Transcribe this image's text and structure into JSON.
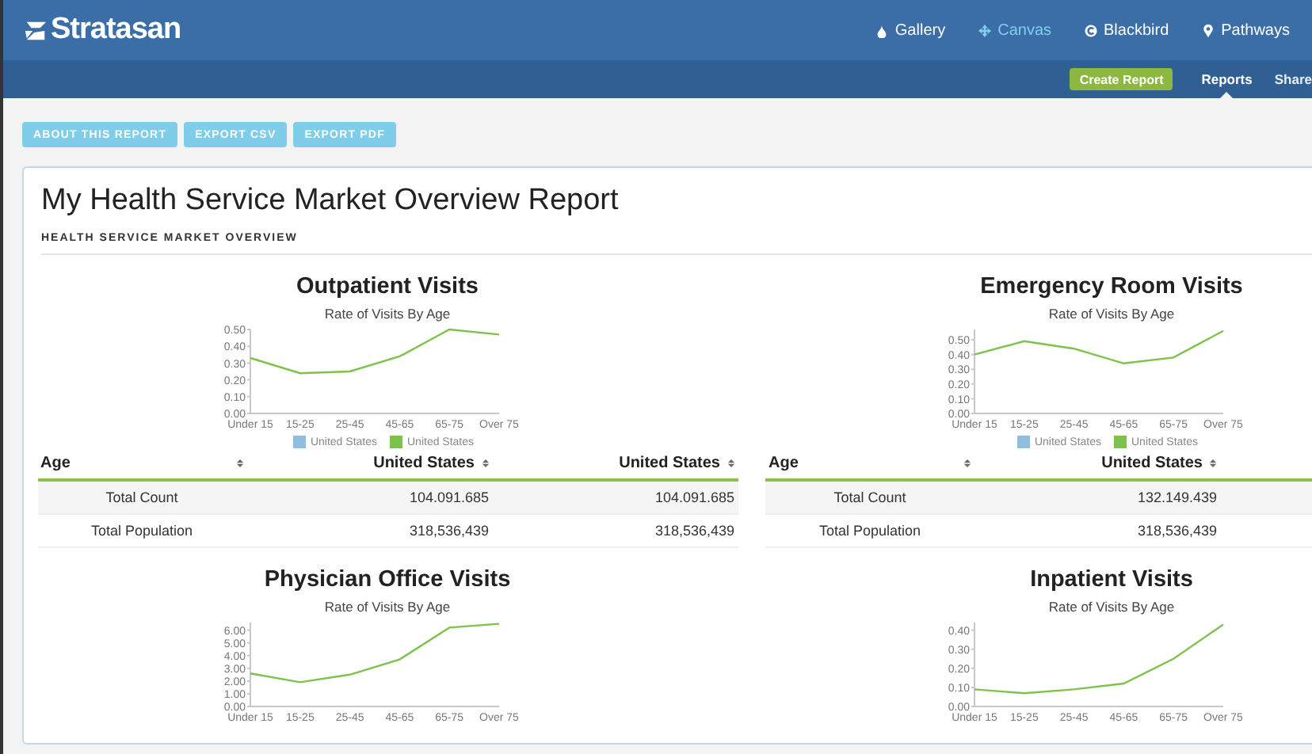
{
  "header": {
    "logo": "Stratasan",
    "nav": [
      {
        "label": "Gallery",
        "kind": "drop",
        "selected": false
      },
      {
        "label": "Canvas",
        "kind": "move",
        "selected": true
      },
      {
        "label": "Blackbird",
        "kind": "ring",
        "selected": false
      },
      {
        "label": "Pathways",
        "kind": "pin",
        "selected": false
      }
    ]
  },
  "subnav": {
    "create_button": "Create Report",
    "tabs": [
      {
        "label": "Reports",
        "selected": true
      },
      {
        "label": "Share",
        "selected": false
      }
    ]
  },
  "actions": [
    "ABOUT THIS REPORT",
    "EXPORT CSV",
    "EXPORT PDF"
  ],
  "report": {
    "title": "My Health Service Market Overview Report",
    "section": "HEALTH SERVICE MARKET OVERVIEW"
  },
  "panels": [
    {
      "title": "Outpatient Visits",
      "chart_data": {
        "type": "line",
        "title": "Rate of Visits By Age",
        "categories": [
          "Under 15",
          "15-25",
          "25-45",
          "45-65",
          "65-75",
          "Over 75"
        ],
        "ylim": [
          0,
          0.5
        ],
        "yticks": [
          {
            "value": 0,
            "label": "0.00"
          },
          {
            "value": 0.1,
            "label": "0.10"
          },
          {
            "value": 0.2,
            "label": "0.20"
          },
          {
            "value": 0.3,
            "label": "0.30"
          },
          {
            "value": 0.4,
            "label": "0.40"
          },
          {
            "value": 0.5,
            "label": "0.50"
          }
        ],
        "series": [
          {
            "name": "United States",
            "color": "#8fbfde",
            "values": [
              null,
              null,
              null,
              null,
              null,
              null
            ]
          },
          {
            "name": "United States",
            "color": "#7dc24b",
            "values": [
              0.33,
              0.24,
              0.25,
              0.34,
              0.5,
              0.47
            ]
          }
        ]
      },
      "table": {
        "columns": [
          "Age",
          "United States",
          "United States"
        ],
        "rows": [
          [
            "Total Count",
            "104.091.685",
            "104.091.685"
          ],
          [
            "Total Population",
            "318,536,439",
            "318,536,439"
          ]
        ]
      }
    },
    {
      "title": "Emergency Room Visits",
      "chart_data": {
        "type": "line",
        "title": "Rate of Visits By Age",
        "categories": [
          "Under 15",
          "15-25",
          "25-45",
          "45-65",
          "65-75",
          "Over 75"
        ],
        "ylim": [
          0,
          0.57
        ],
        "yticks": [
          {
            "value": 0,
            "label": "0.00"
          },
          {
            "value": 0.1,
            "label": "0.10"
          },
          {
            "value": 0.2,
            "label": "0.20"
          },
          {
            "value": 0.3,
            "label": "0.30"
          },
          {
            "value": 0.4,
            "label": "0.40"
          },
          {
            "value": 0.5,
            "label": "0.50"
          }
        ],
        "series": [
          {
            "name": "United States",
            "color": "#8fbfde",
            "values": [
              null,
              null,
              null,
              null,
              null,
              null
            ]
          },
          {
            "name": "United States",
            "color": "#7dc24b",
            "values": [
              0.4,
              0.49,
              0.44,
              0.34,
              0.38,
              0.56
            ]
          }
        ]
      },
      "table": {
        "columns": [
          "Age",
          "United States"
        ],
        "rows": [
          [
            "Total Count",
            "132.149.439"
          ],
          [
            "Total Population",
            "318,536,439"
          ]
        ]
      }
    },
    {
      "title": "Physician Office Visits",
      "chart_data": {
        "type": "line",
        "title": "Rate of Visits By Age",
        "categories": [
          "Under 15",
          "15-25",
          "25-45",
          "45-65",
          "65-75",
          "Over 75"
        ],
        "ylim": [
          0,
          6.6
        ],
        "yticks": [
          {
            "value": 0,
            "label": "0.00"
          },
          {
            "value": 1,
            "label": "1.00"
          },
          {
            "value": 2,
            "label": "2.00"
          },
          {
            "value": 3,
            "label": "3.00"
          },
          {
            "value": 4,
            "label": "4.00"
          },
          {
            "value": 5,
            "label": "5.00"
          },
          {
            "value": 6,
            "label": "6.00"
          }
        ],
        "series": [
          {
            "color": "#7dc24b",
            "values": [
              2.6,
              1.9,
              2.5,
              3.7,
              6.2,
              6.5
            ]
          }
        ]
      }
    },
    {
      "title": "Inpatient Visits",
      "chart_data": {
        "type": "line",
        "title": "Rate of Visits By Age",
        "categories": [
          "Under 15",
          "15-25",
          "25-45",
          "45-65",
          "65-75",
          "Over 75"
        ],
        "ylim": [
          0,
          0.44
        ],
        "yticks": [
          {
            "value": 0,
            "label": "0.00"
          },
          {
            "value": 0.1,
            "label": "0.10"
          },
          {
            "value": 0.2,
            "label": "0.20"
          },
          {
            "value": 0.3,
            "label": "0.30"
          },
          {
            "value": 0.4,
            "label": "0.40"
          }
        ],
        "series": [
          {
            "color": "#7dc24b",
            "values": [
              0.09,
              0.07,
              0.09,
              0.12,
              0.25,
              0.43
            ]
          }
        ]
      }
    }
  ]
}
